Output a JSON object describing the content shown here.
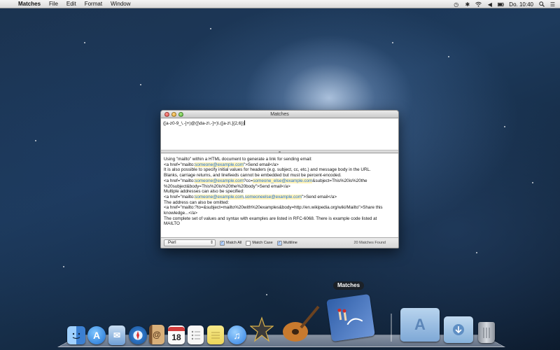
{
  "menubar": {
    "app_name": "Matches",
    "items": [
      "File",
      "Edit",
      "Format",
      "Window"
    ],
    "clock": "Do. 10:40"
  },
  "window": {
    "title": "Matches",
    "regex": "([a-z0-9_\\.-]+)@([\\da-z\\.-]+)\\.([a-z\\.]{2,6})",
    "lines": [
      [
        {
          "t": "Using \"mailto\" within a HTML document to generate a link for sending email:"
        }
      ],
      [
        {
          "t": "<a href=\"mailto:"
        },
        {
          "t": "someone@example.com",
          "m": true
        },
        {
          "t": "\">Send email</a>"
        }
      ],
      [
        {
          "t": "It is also possible to specify initial values for headers (e.g. subject, cc, etc.) and message body in the URL."
        }
      ],
      [
        {
          "t": "Blanks, carriage returns, and linefeeds cannot be embedded but must be percent-encoded."
        }
      ],
      [
        {
          "t": "<a href=\"mailto:"
        },
        {
          "t": "someone@example.com",
          "m": true
        },
        {
          "t": "?cc="
        },
        {
          "t": "someone_else@example.com",
          "m": true
        },
        {
          "t": "&subject=This%20is%20the"
        }
      ],
      [
        {
          "t": "%20subject&body=This%20is%20the%20body\">Send email</a>"
        }
      ],
      [
        {
          "t": "Multiple addresses can also be specified:"
        }
      ],
      [
        {
          "t": "<a href=\"mailto:"
        },
        {
          "t": "someone@example.com",
          "m": true
        },
        {
          "t": ","
        },
        {
          "t": "someoneelse@example.com",
          "m": true
        },
        {
          "t": "\">Send email</a>"
        }
      ],
      [
        {
          "t": "The address can also be omitted:"
        }
      ],
      [
        {
          "t": "<a href=\"mailto:?to=&subject=mailto%20with%20examples&body=http://en.wikipedia.org/wiki/Mailto\">Share this"
        }
      ],
      [
        {
          "t": "knowledge...</a>"
        }
      ],
      [
        {
          "t": "The complete set of values and syntax with examples are listed in RFC-6068. There is example code listed at"
        }
      ],
      [
        {
          "t": "MAILTO"
        }
      ]
    ],
    "flavor": "Perl",
    "options": {
      "match_all": {
        "label": "Match All",
        "checked": true
      },
      "match_case": {
        "label": "Match Case",
        "checked": false
      },
      "multiline": {
        "label": "Multiline",
        "checked": true
      }
    },
    "match_count": "20 Matches Found"
  },
  "dock": {
    "hover_label": "Matches",
    "items": [
      {
        "name": "Finder",
        "icon": "finder-icon",
        "color": "#3b7fd1"
      },
      {
        "name": "App Store",
        "icon": "app-store-icon",
        "color": "#2a8de0"
      },
      {
        "name": "Mail",
        "icon": "mail-icon",
        "color": "#6fa0d8"
      },
      {
        "name": "Safari",
        "icon": "safari-icon",
        "color": "#2e77c9"
      },
      {
        "name": "Contacts",
        "icon": "contacts-icon",
        "color": "#b88a52"
      },
      {
        "name": "Calendar",
        "icon": "calendar-icon",
        "color": "#f2f2f2"
      },
      {
        "name": "Reminders",
        "icon": "reminders-icon",
        "color": "#f5f5f5"
      },
      {
        "name": "Notes",
        "icon": "notes-icon",
        "color": "#f3e27a"
      },
      {
        "name": "iTunes",
        "icon": "itunes-icon",
        "color": "#3c8ee6"
      },
      {
        "name": "iMovie",
        "icon": "imovie-icon",
        "color": "#333333"
      },
      {
        "name": "GarageBand",
        "icon": "garageband-icon",
        "color": "#c2742c"
      },
      {
        "name": "Matches",
        "icon": "matches-icon",
        "color": "#3163b5"
      },
      {
        "name": "Applications",
        "icon": "applications-folder-icon",
        "color": "#8fb6de"
      },
      {
        "name": "Downloads",
        "icon": "downloads-stack-icon",
        "color": "#9cc0e2"
      },
      {
        "name": "Trash",
        "icon": "trash-icon",
        "color": "#b9bfc8"
      }
    ],
    "calendar_day": "18"
  }
}
